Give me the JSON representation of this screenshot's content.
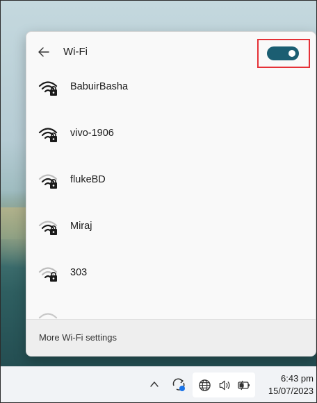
{
  "wifi_panel": {
    "title": "Wi-Fi",
    "toggle_on": true,
    "networks": [
      {
        "name": "BabuirBasha",
        "icon": "wifi-secured-icon"
      },
      {
        "name": "vivo-1906",
        "icon": "wifi-secured-icon"
      },
      {
        "name": "flukeBD",
        "icon": "wifi-secured-icon"
      },
      {
        "name": "Miraj",
        "icon": "wifi-secured-icon"
      },
      {
        "name": "303",
        "icon": "wifi-secured-icon"
      }
    ],
    "footer_link": "More Wi-Fi settings"
  },
  "taskbar": {
    "time": "6:43 pm",
    "date": "15/07/2023",
    "icons": [
      "chevron-up-icon",
      "sync-icon",
      "globe-network-icon",
      "volume-icon",
      "battery-icon"
    ]
  },
  "colors": {
    "toggle": "#1b5e72",
    "highlight": "#e53137"
  }
}
